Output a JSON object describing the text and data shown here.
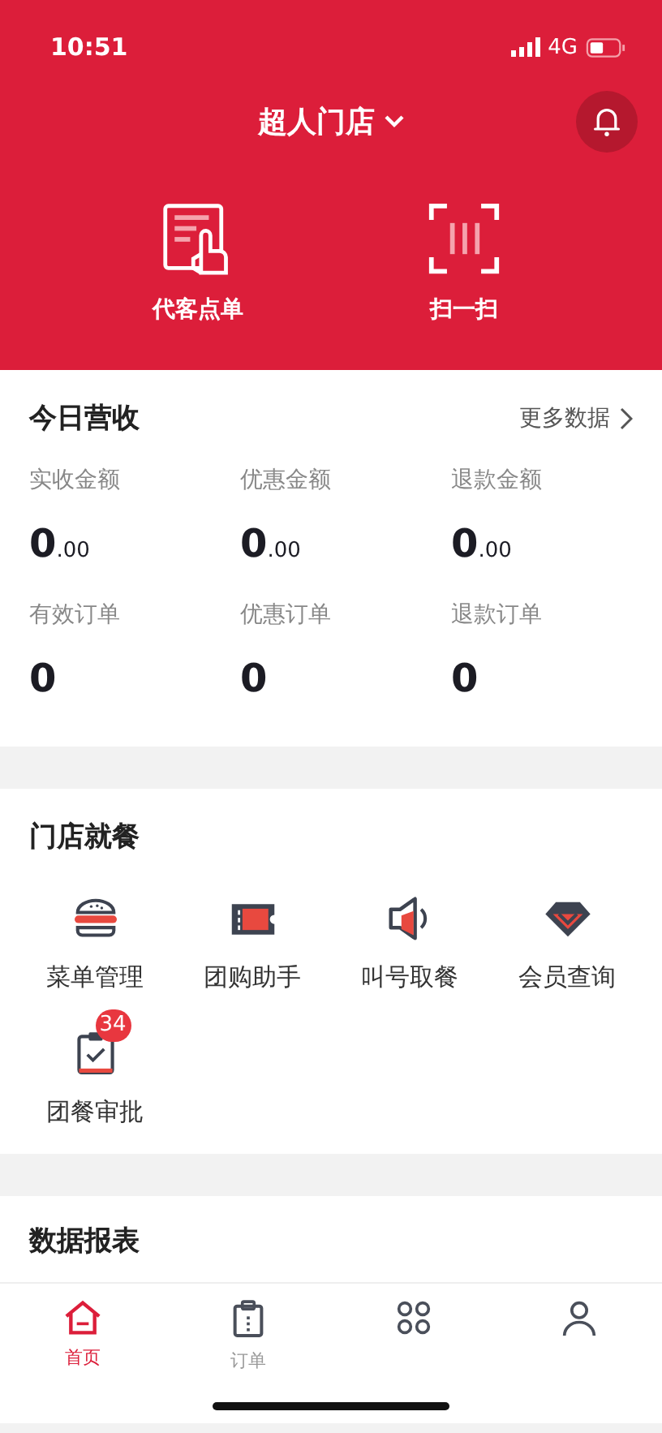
{
  "status_bar": {
    "time": "10:51",
    "network": "4G"
  },
  "header": {
    "store_name": "超人门店",
    "actions": [
      {
        "kind": "order",
        "label": "代客点单"
      },
      {
        "kind": "scan",
        "label": "扫一扫"
      }
    ]
  },
  "revenue": {
    "title": "今日营收",
    "more_link": "更多数据",
    "stats": [
      {
        "label": "实收金额",
        "value": "0",
        "decimals": ".00"
      },
      {
        "label": "优惠金额",
        "value": "0",
        "decimals": ".00"
      },
      {
        "label": "退款金额",
        "value": "0",
        "decimals": ".00"
      },
      {
        "label": "有效订单",
        "value": "0"
      },
      {
        "label": "优惠订单",
        "value": "0"
      },
      {
        "label": "退款订单",
        "value": "0"
      }
    ]
  },
  "dining": {
    "title": "门店就餐",
    "items": [
      {
        "kind": "burger",
        "label": "菜单管理"
      },
      {
        "kind": "ticket",
        "label": "团购助手"
      },
      {
        "kind": "speaker",
        "label": "叫号取餐"
      },
      {
        "kind": "gem",
        "label": "会员查询"
      },
      {
        "kind": "clipboard",
        "label": "团餐审批",
        "badge": "34"
      }
    ]
  },
  "reports": {
    "title": "数据报表"
  },
  "tab_bar": [
    {
      "kind": "home",
      "label": "首页",
      "selected": true
    },
    {
      "kind": "orders",
      "label": "订单",
      "selected": false
    },
    {
      "kind": "apps",
      "selected": false
    },
    {
      "kind": "profile",
      "selected": false
    }
  ]
}
